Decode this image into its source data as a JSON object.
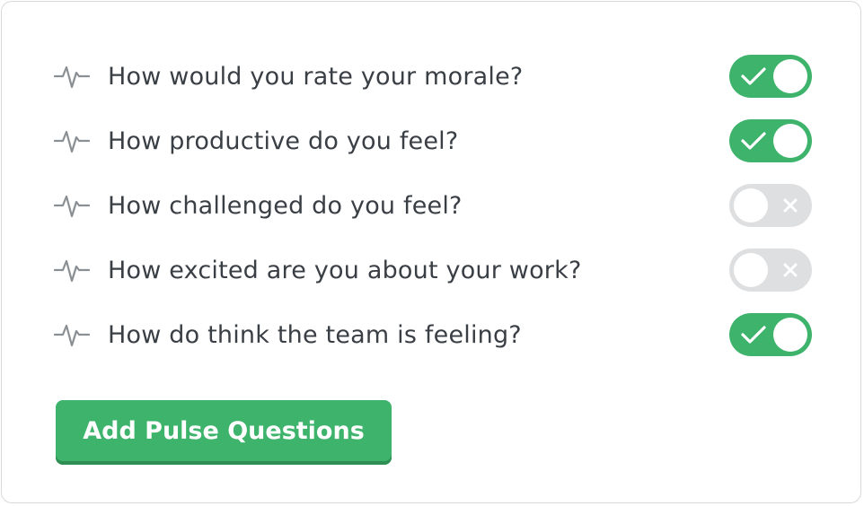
{
  "questions": [
    {
      "text": "How would you rate your morale?",
      "enabled": true
    },
    {
      "text": "How productive do you feel?",
      "enabled": true
    },
    {
      "text": "How challenged do you feel?",
      "enabled": false
    },
    {
      "text": "How excited are you about your work?",
      "enabled": false
    },
    {
      "text": "How do think the team is feeling?",
      "enabled": true
    }
  ],
  "add_button_label": "Add Pulse Questions",
  "colors": {
    "accent": "#3db36b",
    "toggle_off": "#dedfe1",
    "text": "#3a3f45",
    "icon": "#8a8f94"
  },
  "icons": {
    "question": "pulse-icon",
    "on": "check-icon",
    "off": "close-icon"
  }
}
